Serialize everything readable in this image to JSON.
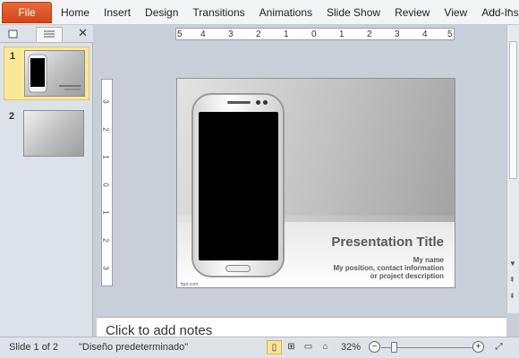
{
  "ribbon": {
    "file_tab": "File",
    "tabs": [
      "Home",
      "Insert",
      "Design",
      "Transitions",
      "Animations",
      "Slide Show",
      "Review",
      "View",
      "Add-Ins"
    ],
    "icons": [
      "heart-icon",
      "chevron-down-icon",
      "help-icon"
    ]
  },
  "slides_panel": {
    "close_label": "✕",
    "slides": [
      {
        "number": "1",
        "selected": true
      },
      {
        "number": "2",
        "selected": false
      }
    ]
  },
  "ruler": {
    "h_ticks": [
      "5",
      "4",
      "3",
      "2",
      "1",
      "0",
      "1",
      "2",
      "3",
      "4",
      "5"
    ],
    "v_ticks": [
      "3",
      "2",
      "1",
      "0",
      "1",
      "2",
      "3"
    ]
  },
  "slide": {
    "title": "Presentation Title",
    "subtitle_lines": [
      "My name",
      "My position, contact information",
      "or project description"
    ],
    "footer": "fppt.com"
  },
  "notes": {
    "placeholder": "Click to add notes"
  },
  "status_bar": {
    "slide_info": "Slide 1 of 2",
    "theme": "\"Diseño predeterminado\"",
    "zoom": "32%",
    "zoom_fraction": 0.32
  }
}
